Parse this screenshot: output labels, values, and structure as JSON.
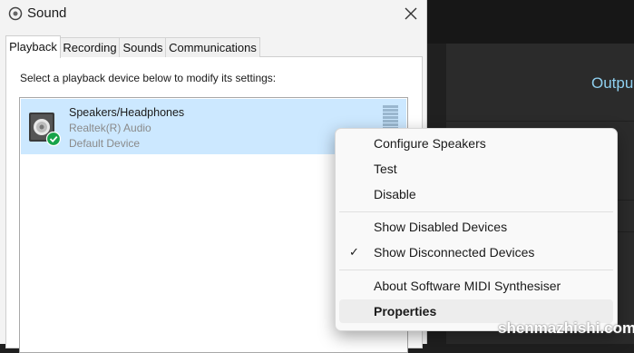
{
  "background_app": {
    "heading": "Outpu"
  },
  "dialog": {
    "title": "Sound",
    "tabs": [
      {
        "label": "Playback",
        "active": true
      },
      {
        "label": "Recording",
        "active": false
      },
      {
        "label": "Sounds",
        "active": false
      },
      {
        "label": "Communications",
        "active": false
      }
    ],
    "instruction": "Select a playback device below to modify its settings:",
    "devices": [
      {
        "name": "Speakers/Headphones",
        "driver": "Realtek(R) Audio",
        "status": "Default Device",
        "selected": true
      }
    ]
  },
  "context_menu": {
    "items": [
      {
        "label": "Configure Speakers"
      },
      {
        "label": "Test"
      },
      {
        "label": "Disable"
      },
      {
        "label": "Show Disabled Devices",
        "checked": false
      },
      {
        "label": "Show Disconnected Devices",
        "checked": true
      },
      {
        "label": "About Software MIDI Synthesiser"
      },
      {
        "label": "Properties",
        "highlighted": true
      }
    ]
  },
  "watermark": "shenmazhishi.com",
  "colors": {
    "selection": "#cce8ff",
    "check_badge": "#16a34a",
    "accent_text": "#8fd0f0"
  }
}
